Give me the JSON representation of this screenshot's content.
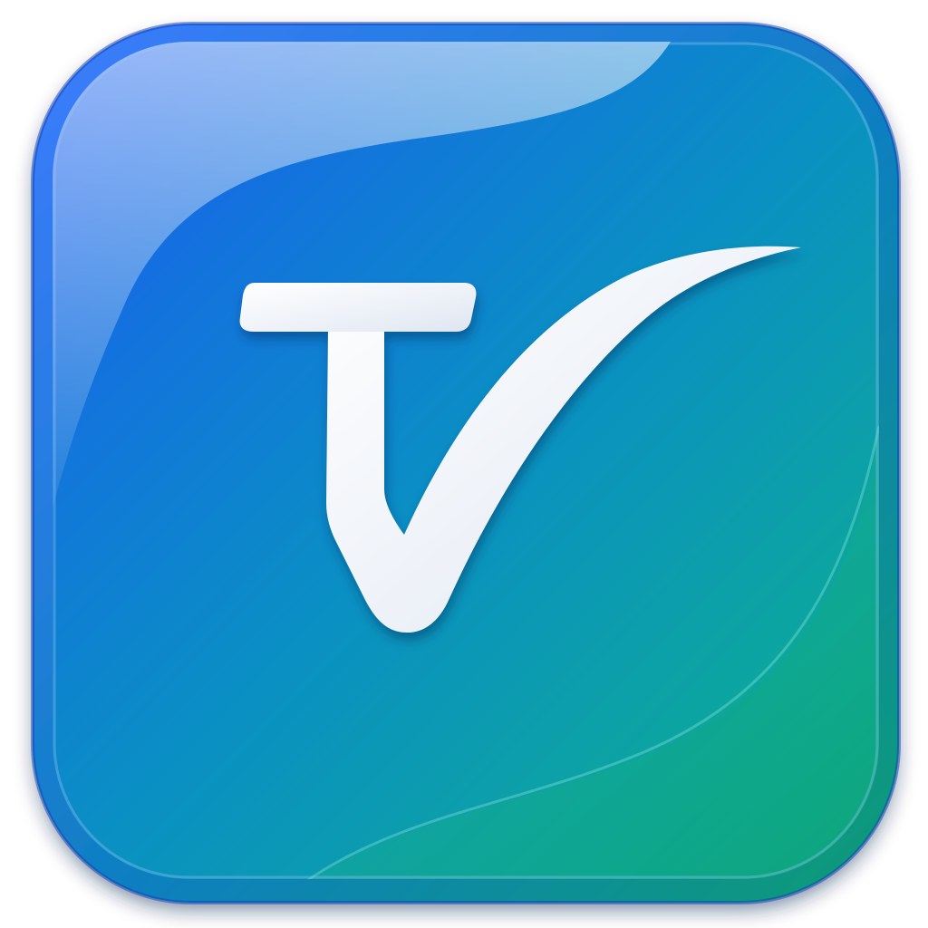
{
  "icon": {
    "glyph": "tv-check-mark-icon",
    "colors": {
      "background": "#ffffff",
      "gradient_start": "#1a5cf2",
      "gradient_mid": "#0a8fc4",
      "gradient_end": "#0eb38a",
      "rim_dark": "#0d3fb8",
      "glyph_fill": "#ffffff",
      "glyph_shade": "#dfe6f2"
    }
  }
}
